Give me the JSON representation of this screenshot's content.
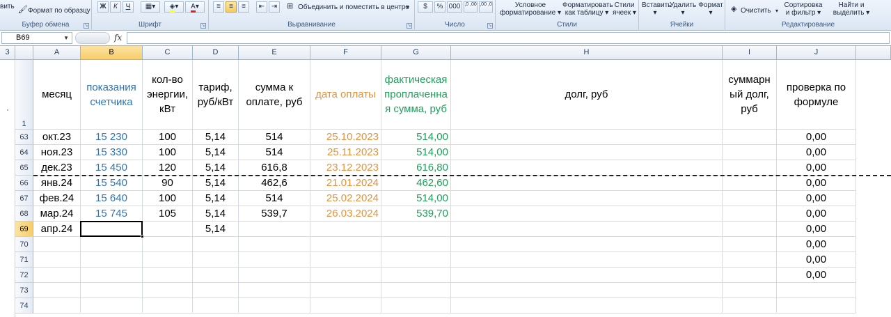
{
  "ribbon": {
    "clipboard": {
      "paste_cut": "вить",
      "format_painter": "Формат по образцу",
      "label": "Буфер обмена"
    },
    "font": {
      "bold": "Ж",
      "italic": "К",
      "underline": "Ч",
      "label": "Шрифт"
    },
    "alignment": {
      "merge_center": "Объединить и поместить в центре",
      "label": "Выравнивание"
    },
    "number": {
      "currency": "$",
      "percent": "%",
      "thousands": "000",
      "inc_dec": ",0 ,00",
      "dec_dec": ",00 ,0",
      "label": "Число"
    },
    "styles": {
      "conditional_line1": "Условное",
      "conditional_line2": "форматирование",
      "table_line1": "Форматировать",
      "table_line2": "как таблицу",
      "cell_line1": "Стили",
      "cell_line2": "ячеек",
      "label": "Стили"
    },
    "cells": {
      "insert": "Вставить",
      "delete": "Удалить",
      "format": "Формат",
      "label": "Ячейки"
    },
    "editing": {
      "clear": "Очистить",
      "sort_line1": "Сортировка",
      "sort_line2": "и фильтр",
      "find_line1": "Найти и",
      "find_line2": "выделить",
      "label": "Редактирование"
    }
  },
  "formula_bar": {
    "name_box": "B69",
    "fx": "fx",
    "formula": ""
  },
  "outline_level": "3",
  "columns": [
    "A",
    "B",
    "C",
    "D",
    "E",
    "F",
    "G",
    "H",
    "I",
    "J"
  ],
  "header_row": {
    "row_number": "1",
    "cells": [
      "месяц",
      "показания\nсчетчика",
      "кол-во\nэнергии,\nкВт",
      "тариф,\nруб/кВт",
      "сумма к\nоплате, руб",
      "дата оплаты",
      "фактическая\nпроплаченна\nя сумма, руб",
      "долг, руб",
      "суммарн\nый долг,\nруб",
      "проверка по\nформуле"
    ]
  },
  "rows": [
    {
      "num": "63",
      "cells": [
        "окт.23",
        "15 230",
        "100",
        "5,14",
        "514",
        "25.10.2023",
        "514,00",
        "",
        "",
        "0,00"
      ]
    },
    {
      "num": "64",
      "cells": [
        "ноя.23",
        "15 330",
        "100",
        "5,14",
        "514",
        "25.11.2023",
        "514,00",
        "",
        "",
        "0,00"
      ]
    },
    {
      "num": "65",
      "cells": [
        "дек.23",
        "15 450",
        "120",
        "5,14",
        "616,8",
        "23.12.2023",
        "616,80",
        "",
        "",
        "0,00"
      ]
    },
    {
      "num": "66",
      "cells": [
        "янв.24",
        "15 540",
        "90",
        "5,14",
        "462,6",
        "21.01.2024",
        "462,60",
        "",
        "",
        "0,00"
      ]
    },
    {
      "num": "67",
      "cells": [
        "фев.24",
        "15 640",
        "100",
        "5,14",
        "514",
        "25.02.2024",
        "514,00",
        "",
        "",
        "0,00"
      ]
    },
    {
      "num": "68",
      "cells": [
        "мар.24",
        "15 745",
        "105",
        "5,14",
        "539,7",
        "26.03.2024",
        "539,70",
        "",
        "",
        "0,00"
      ]
    },
    {
      "num": "69",
      "cells": [
        "апр.24",
        "",
        "",
        "5,14",
        "",
        "",
        "",
        "",
        "",
        "0,00"
      ]
    },
    {
      "num": "70",
      "cells": [
        "",
        "",
        "",
        "",
        "",
        "",
        "",
        "",
        "",
        "0,00"
      ]
    },
    {
      "num": "71",
      "cells": [
        "",
        "",
        "",
        "",
        "",
        "",
        "",
        "",
        "",
        "0,00"
      ]
    },
    {
      "num": "72",
      "cells": [
        "",
        "",
        "",
        "",
        "",
        "",
        "",
        "",
        "",
        "0,00"
      ]
    },
    {
      "num": "73",
      "cells": [
        "",
        "",
        "",
        "",
        "",
        "",
        "",
        "",
        "",
        ""
      ]
    },
    {
      "num": "74",
      "cells": [
        "",
        "",
        "",
        "",
        "",
        "",
        "",
        "",
        "",
        ""
      ]
    }
  ],
  "selection": {
    "column": "B",
    "row": "69"
  },
  "colors": {
    "counter_blue": "#2e75b6",
    "date_orange": "#e4923b",
    "paid_green": "#1ea05a"
  }
}
